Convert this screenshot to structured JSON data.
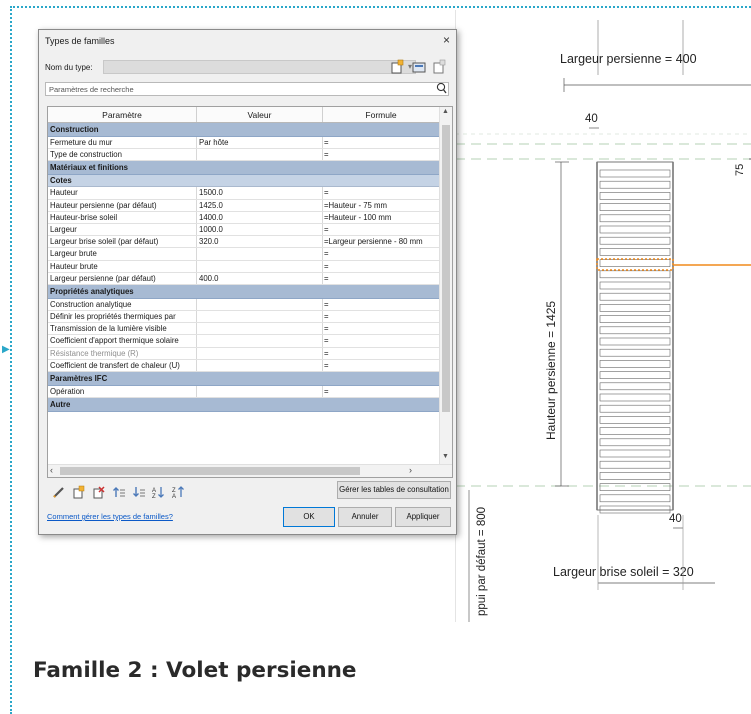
{
  "dialog": {
    "title": "Types de familles",
    "close": "×",
    "type_label": "Nom du type:",
    "search_placeholder": "Paramètres de recherche",
    "columns": [
      "Paramètre",
      "Valeur",
      "Formule"
    ],
    "sections": [
      {
        "kind": "section",
        "label": "Construction"
      },
      {
        "kind": "row",
        "param": "Fermeture du mur",
        "value": "Par hôte",
        "formula": "="
      },
      {
        "kind": "row",
        "param": "Type de construction",
        "value": "",
        "formula": "="
      },
      {
        "kind": "section",
        "label": "Matériaux et finitions"
      },
      {
        "kind": "subsection",
        "label": "Cotes"
      },
      {
        "kind": "row",
        "param": "Hauteur",
        "value": "1500.0",
        "formula": "="
      },
      {
        "kind": "row",
        "param": "Hauteur persienne (par défaut)",
        "value": "1425.0",
        "formula": "=Hauteur - 75 mm"
      },
      {
        "kind": "row",
        "param": "Hauteur-brise soleil",
        "value": "1400.0",
        "formula": "=Hauteur - 100 mm"
      },
      {
        "kind": "row",
        "param": "Largeur",
        "value": "1000.0",
        "formula": "="
      },
      {
        "kind": "row",
        "param": "Largeur brise soleil (par défaut)",
        "value": "320.0",
        "formula": "=Largeur persienne - 80 mm"
      },
      {
        "kind": "row",
        "param": "Largeur brute",
        "value": "",
        "formula": "="
      },
      {
        "kind": "row",
        "param": "Hauteur brute",
        "value": "",
        "formula": "="
      },
      {
        "kind": "row",
        "param": "Largeur persienne (par défaut)",
        "value": "400.0",
        "formula": "="
      },
      {
        "kind": "section",
        "label": "Propriétés analytiques"
      },
      {
        "kind": "row",
        "param": "Construction analytique",
        "value": "",
        "formula": "="
      },
      {
        "kind": "row",
        "param": "Définir les propriétés thermiques par",
        "value": "",
        "formula": "="
      },
      {
        "kind": "row",
        "param": "Transmission de la lumière visible",
        "value": "",
        "formula": "="
      },
      {
        "kind": "row",
        "param": "Coefficient d'apport thermique solaire",
        "value": "",
        "formula": "="
      },
      {
        "kind": "row",
        "param": "Résistance thermique (R)",
        "value": "",
        "formula": "=",
        "grey": true
      },
      {
        "kind": "row",
        "param": "Coefficient de transfert de chaleur (U)",
        "value": "",
        "formula": "="
      },
      {
        "kind": "section",
        "label": "Paramètres IFC"
      },
      {
        "kind": "row",
        "param": "Opération",
        "value": "",
        "formula": "="
      },
      {
        "kind": "section",
        "label": "Autre"
      }
    ],
    "manage_lookup_label": "Gérer les tables de consultation",
    "help_link": "Comment gérer les types de familles?",
    "ok_label": "OK",
    "cancel_label": "Annuler",
    "apply_label": "Appliquer",
    "bottom_icons": [
      "pencil-icon",
      "new-type-icon",
      "rename-type-icon",
      "move-up-icon",
      "move-down-icon",
      "sort-asc-icon",
      "sort-desc-icon"
    ]
  },
  "drawing": {
    "dim_top": "Largeur persienne = 400",
    "dim_40_top": "40",
    "dim_75": "75",
    "dim_height": "Hauteur persienne = 1425",
    "dim_40_bottom": "40",
    "dim_bottom": "Largeur brise soleil = 320",
    "dim_appui": "ppui par défaut = 800",
    "highlight_color": "#f08a1c"
  },
  "caption": "Famille 2 : Volet persienne"
}
